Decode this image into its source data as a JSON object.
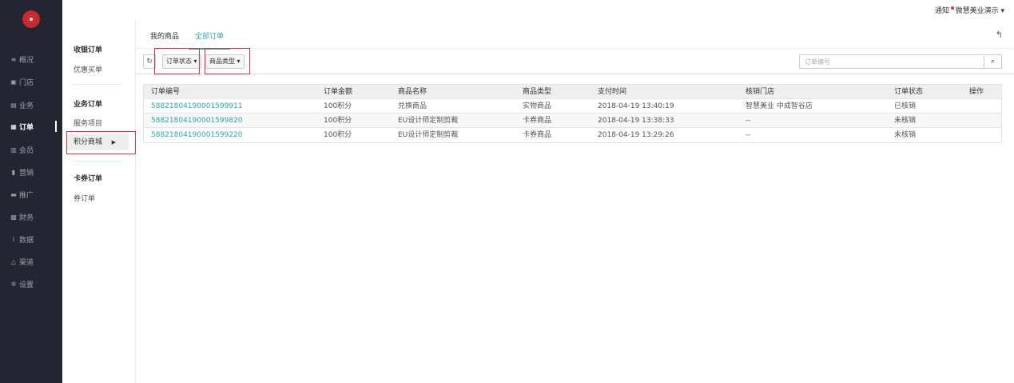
{
  "nav": {
    "items": [
      {
        "icon": "≡",
        "label": "概况"
      },
      {
        "icon": "▣",
        "label": "门店"
      },
      {
        "icon": "▤",
        "label": "业务"
      },
      {
        "icon": "▦",
        "label": "订单"
      },
      {
        "icon": "▥",
        "label": "会员"
      },
      {
        "icon": "▮",
        "label": "营销"
      },
      {
        "icon": "▬",
        "label": "推广"
      },
      {
        "icon": "▩",
        "label": "财务"
      },
      {
        "icon": "⌇",
        "label": "数据"
      },
      {
        "icon": "△",
        "label": "渠道"
      },
      {
        "icon": "✲",
        "label": "设置"
      }
    ],
    "active_index": 3
  },
  "topbar": {
    "notice": "通知",
    "user": "微慧美业演示 ▾"
  },
  "subnav": {
    "group1_title": "收银订单",
    "group1_item1": "优惠买单",
    "group2_title": "业务订单",
    "group2_item1": "服务项目",
    "group2_item2": "积分商城",
    "group3_title": "卡券订单",
    "group3_item1": "券订单"
  },
  "tabs": {
    "tab1": "我的商品",
    "tab2": "全部订单"
  },
  "filters": {
    "refresh_icon": "↻",
    "status": "订单状态 ▾",
    "type": "商品类型 ▾",
    "search_placeholder": "订单编号",
    "search_icon": "⌕"
  },
  "table": {
    "headers": [
      "订单编号",
      "订单金额",
      "商品名称",
      "商品类型",
      "支付时间",
      "核销门店",
      "订单状态",
      "操作"
    ],
    "rows": [
      [
        "58821804190001599911",
        "100积分",
        "兑换商品",
        "实物商品",
        "2018-04-19 13:40:19",
        "智慧美业 中成智谷店",
        "已核销",
        ""
      ],
      [
        "58821804190001599820",
        "100积分",
        "EU设计师定制剪裁",
        "卡券商品",
        "2018-04-19 13:38:33",
        "--",
        "未核销",
        ""
      ],
      [
        "58821804190001599220",
        "100积分",
        "EU设计师定制剪裁",
        "卡券商品",
        "2018-04-19 13:29:26",
        "--",
        "未核销",
        ""
      ]
    ]
  },
  "colors": {
    "accent": "#29a9a9",
    "nav_bg": "#232530",
    "highlight_box": "#e0323a",
    "logo": "#c8272d"
  }
}
